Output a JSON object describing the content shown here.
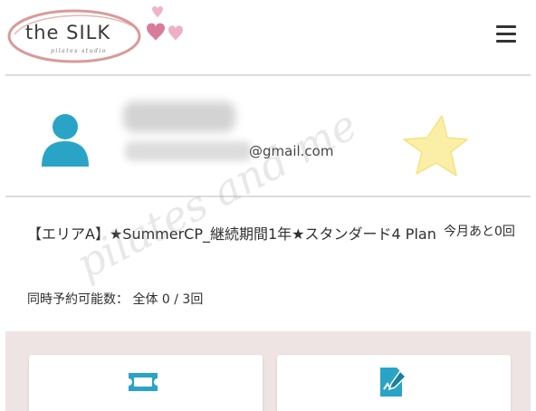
{
  "header": {
    "logo_text": "the SILK",
    "logo_subtitle": "pilates studio",
    "menu_icon": "hamburger-menu-icon"
  },
  "profile": {
    "email_suffix": "@gmail.com",
    "avatar_icon": "user-avatar-icon"
  },
  "plan": {
    "title": "【エリアA】★SummerCP_継続期間1年★スタンダード4 Plan",
    "remaining": "今月あと0回",
    "quota_label": "同時予約可能数：",
    "quota_value": "全体 0 / 3回"
  },
  "watermark": "pilates and me",
  "cards": [
    {
      "icon": "ticket-icon"
    },
    {
      "icon": "edit-document-icon"
    }
  ],
  "colors": {
    "accent": "#2aa4c6",
    "logo_ring": "#d99a9a",
    "heart_pink": "#e7a3b7",
    "star": "#fbefa8",
    "divider": "#dcdcdc",
    "bottom_bg": "#efe4e4"
  }
}
